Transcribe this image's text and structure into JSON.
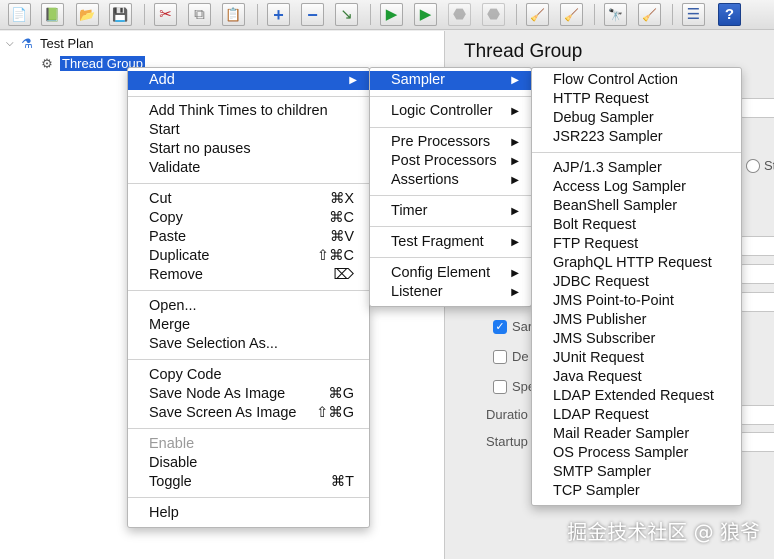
{
  "toolbar": {
    "buttons": [
      {
        "icon": "new-icon",
        "glyph": "📄"
      },
      {
        "icon": "templates-icon",
        "glyph": "📗"
      },
      {
        "icon": "open-icon",
        "glyph": "📂"
      },
      {
        "icon": "save-icon",
        "glyph": "💾"
      },
      {
        "icon": "cut-icon",
        "glyph": "✂"
      },
      {
        "icon": "copy-icon",
        "glyph": "⧉"
      },
      {
        "icon": "paste-icon",
        "glyph": "📋"
      },
      {
        "icon": "expand-icon",
        "glyph": "+"
      },
      {
        "icon": "collapse-icon",
        "glyph": "−"
      },
      {
        "icon": "toggle-icon",
        "glyph": "↘"
      },
      {
        "icon": "start-icon",
        "glyph": "▶"
      },
      {
        "icon": "start-no-pauses-icon",
        "glyph": "▶"
      },
      {
        "icon": "stop-icon",
        "glyph": "⬣"
      },
      {
        "icon": "shutdown-icon",
        "glyph": "⬣"
      },
      {
        "icon": "clear-icon",
        "glyph": "🧹"
      },
      {
        "icon": "clear-all-icon",
        "glyph": "🧹"
      },
      {
        "icon": "search-icon",
        "glyph": "🔭"
      },
      {
        "icon": "reset-search-icon",
        "glyph": "🧹"
      },
      {
        "icon": "function-helper-icon",
        "glyph": "☰"
      },
      {
        "icon": "help-icon",
        "glyph": "?"
      }
    ]
  },
  "tree": {
    "root_label": "Test Plan",
    "child_label": "Thread Group"
  },
  "right_panel": {
    "title": "Thread Group",
    "partial_labels": {
      "sam": "Sar",
      "del": "De",
      "spe": "Spe",
      "duration": "Duratio",
      "startup": "Startup",
      "radio_tail": "St"
    }
  },
  "context_menu": {
    "add": "Add",
    "add_think_times": "Add Think Times to children",
    "start": "Start",
    "start_no_pauses": "Start no pauses",
    "validate": "Validate",
    "cut": "Cut",
    "cut_sc": "⌘X",
    "copy": "Copy",
    "copy_sc": "⌘C",
    "paste": "Paste",
    "paste_sc": "⌘V",
    "duplicate": "Duplicate",
    "duplicate_sc": "⇧⌘C",
    "remove": "Remove",
    "remove_sc": "⌦",
    "open": "Open...",
    "merge": "Merge",
    "save_selection_as": "Save Selection As...",
    "copy_code": "Copy Code",
    "save_node_as_image": "Save Node As Image",
    "save_node_sc": "⌘G",
    "save_screen_as_image": "Save Screen As Image",
    "save_screen_sc": "⇧⌘G",
    "enable": "Enable",
    "disable": "Disable",
    "toggle": "Toggle",
    "toggle_sc": "⌘T",
    "help": "Help"
  },
  "add_submenu": {
    "sampler": "Sampler",
    "logic_controller": "Logic Controller",
    "pre_processors": "Pre Processors",
    "post_processors": "Post Processors",
    "assertions": "Assertions",
    "timer": "Timer",
    "test_fragment": "Test Fragment",
    "config_element": "Config Element",
    "listener": "Listener"
  },
  "sampler_submenu": {
    "flow_control_action": "Flow Control Action",
    "http_request": "HTTP Request",
    "debug_sampler": "Debug Sampler",
    "jsr223_sampler": "JSR223 Sampler",
    "ajp_sampler": "AJP/1.3 Sampler",
    "access_log_sampler": "Access Log Sampler",
    "beanshell_sampler": "BeanShell Sampler",
    "bolt_request": "Bolt Request",
    "ftp_request": "FTP Request",
    "graphql_http_request": "GraphQL HTTP Request",
    "jdbc_request": "JDBC Request",
    "jms_point_to_point": "JMS Point-to-Point",
    "jms_publisher": "JMS Publisher",
    "jms_subscriber": "JMS Subscriber",
    "junit_request": "JUnit Request",
    "java_request": "Java Request",
    "ldap_extended_request": "LDAP Extended Request",
    "ldap_request": "LDAP Request",
    "mail_reader_sampler": "Mail Reader Sampler",
    "os_process_sampler": "OS Process Sampler",
    "smtp_sampler": "SMTP Sampler",
    "tcp_sampler": "TCP Sampler"
  },
  "watermark": "掘金技术社区 @ 狼爷"
}
